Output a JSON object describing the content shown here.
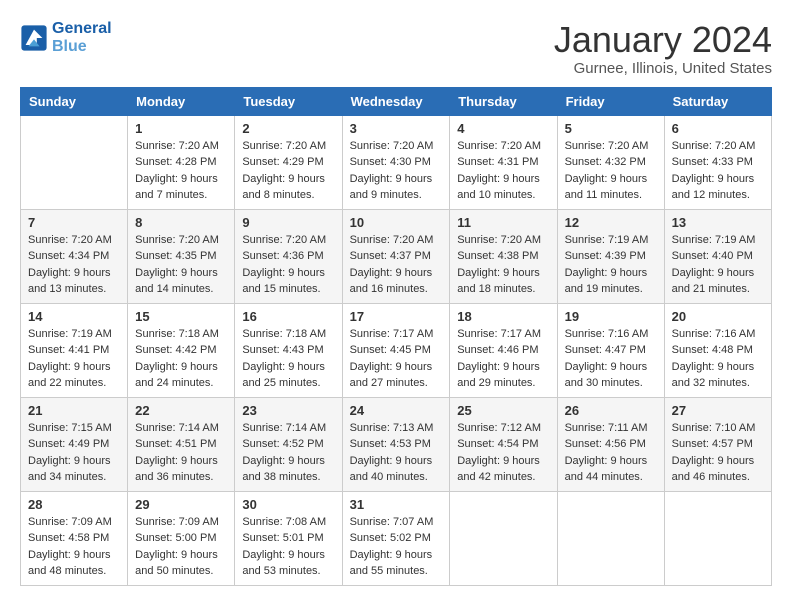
{
  "header": {
    "logo_line1": "General",
    "logo_line2": "Blue",
    "title": "January 2024",
    "location": "Gurnee, Illinois, United States"
  },
  "columns": [
    "Sunday",
    "Monday",
    "Tuesday",
    "Wednesday",
    "Thursday",
    "Friday",
    "Saturday"
  ],
  "weeks": [
    [
      {
        "day": "",
        "sunrise": "",
        "sunset": "",
        "daylight": ""
      },
      {
        "day": "1",
        "sunrise": "Sunrise: 7:20 AM",
        "sunset": "Sunset: 4:28 PM",
        "daylight": "Daylight: 9 hours and 7 minutes."
      },
      {
        "day": "2",
        "sunrise": "Sunrise: 7:20 AM",
        "sunset": "Sunset: 4:29 PM",
        "daylight": "Daylight: 9 hours and 8 minutes."
      },
      {
        "day": "3",
        "sunrise": "Sunrise: 7:20 AM",
        "sunset": "Sunset: 4:30 PM",
        "daylight": "Daylight: 9 hours and 9 minutes."
      },
      {
        "day": "4",
        "sunrise": "Sunrise: 7:20 AM",
        "sunset": "Sunset: 4:31 PM",
        "daylight": "Daylight: 9 hours and 10 minutes."
      },
      {
        "day": "5",
        "sunrise": "Sunrise: 7:20 AM",
        "sunset": "Sunset: 4:32 PM",
        "daylight": "Daylight: 9 hours and 11 minutes."
      },
      {
        "day": "6",
        "sunrise": "Sunrise: 7:20 AM",
        "sunset": "Sunset: 4:33 PM",
        "daylight": "Daylight: 9 hours and 12 minutes."
      }
    ],
    [
      {
        "day": "7",
        "sunrise": "Sunrise: 7:20 AM",
        "sunset": "Sunset: 4:34 PM",
        "daylight": "Daylight: 9 hours and 13 minutes."
      },
      {
        "day": "8",
        "sunrise": "Sunrise: 7:20 AM",
        "sunset": "Sunset: 4:35 PM",
        "daylight": "Daylight: 9 hours and 14 minutes."
      },
      {
        "day": "9",
        "sunrise": "Sunrise: 7:20 AM",
        "sunset": "Sunset: 4:36 PM",
        "daylight": "Daylight: 9 hours and 15 minutes."
      },
      {
        "day": "10",
        "sunrise": "Sunrise: 7:20 AM",
        "sunset": "Sunset: 4:37 PM",
        "daylight": "Daylight: 9 hours and 16 minutes."
      },
      {
        "day": "11",
        "sunrise": "Sunrise: 7:20 AM",
        "sunset": "Sunset: 4:38 PM",
        "daylight": "Daylight: 9 hours and 18 minutes."
      },
      {
        "day": "12",
        "sunrise": "Sunrise: 7:19 AM",
        "sunset": "Sunset: 4:39 PM",
        "daylight": "Daylight: 9 hours and 19 minutes."
      },
      {
        "day": "13",
        "sunrise": "Sunrise: 7:19 AM",
        "sunset": "Sunset: 4:40 PM",
        "daylight": "Daylight: 9 hours and 21 minutes."
      }
    ],
    [
      {
        "day": "14",
        "sunrise": "Sunrise: 7:19 AM",
        "sunset": "Sunset: 4:41 PM",
        "daylight": "Daylight: 9 hours and 22 minutes."
      },
      {
        "day": "15",
        "sunrise": "Sunrise: 7:18 AM",
        "sunset": "Sunset: 4:42 PM",
        "daylight": "Daylight: 9 hours and 24 minutes."
      },
      {
        "day": "16",
        "sunrise": "Sunrise: 7:18 AM",
        "sunset": "Sunset: 4:43 PM",
        "daylight": "Daylight: 9 hours and 25 minutes."
      },
      {
        "day": "17",
        "sunrise": "Sunrise: 7:17 AM",
        "sunset": "Sunset: 4:45 PM",
        "daylight": "Daylight: 9 hours and 27 minutes."
      },
      {
        "day": "18",
        "sunrise": "Sunrise: 7:17 AM",
        "sunset": "Sunset: 4:46 PM",
        "daylight": "Daylight: 9 hours and 29 minutes."
      },
      {
        "day": "19",
        "sunrise": "Sunrise: 7:16 AM",
        "sunset": "Sunset: 4:47 PM",
        "daylight": "Daylight: 9 hours and 30 minutes."
      },
      {
        "day": "20",
        "sunrise": "Sunrise: 7:16 AM",
        "sunset": "Sunset: 4:48 PM",
        "daylight": "Daylight: 9 hours and 32 minutes."
      }
    ],
    [
      {
        "day": "21",
        "sunrise": "Sunrise: 7:15 AM",
        "sunset": "Sunset: 4:49 PM",
        "daylight": "Daylight: 9 hours and 34 minutes."
      },
      {
        "day": "22",
        "sunrise": "Sunrise: 7:14 AM",
        "sunset": "Sunset: 4:51 PM",
        "daylight": "Daylight: 9 hours and 36 minutes."
      },
      {
        "day": "23",
        "sunrise": "Sunrise: 7:14 AM",
        "sunset": "Sunset: 4:52 PM",
        "daylight": "Daylight: 9 hours and 38 minutes."
      },
      {
        "day": "24",
        "sunrise": "Sunrise: 7:13 AM",
        "sunset": "Sunset: 4:53 PM",
        "daylight": "Daylight: 9 hours and 40 minutes."
      },
      {
        "day": "25",
        "sunrise": "Sunrise: 7:12 AM",
        "sunset": "Sunset: 4:54 PM",
        "daylight": "Daylight: 9 hours and 42 minutes."
      },
      {
        "day": "26",
        "sunrise": "Sunrise: 7:11 AM",
        "sunset": "Sunset: 4:56 PM",
        "daylight": "Daylight: 9 hours and 44 minutes."
      },
      {
        "day": "27",
        "sunrise": "Sunrise: 7:10 AM",
        "sunset": "Sunset: 4:57 PM",
        "daylight": "Daylight: 9 hours and 46 minutes."
      }
    ],
    [
      {
        "day": "28",
        "sunrise": "Sunrise: 7:09 AM",
        "sunset": "Sunset: 4:58 PM",
        "daylight": "Daylight: 9 hours and 48 minutes."
      },
      {
        "day": "29",
        "sunrise": "Sunrise: 7:09 AM",
        "sunset": "Sunset: 5:00 PM",
        "daylight": "Daylight: 9 hours and 50 minutes."
      },
      {
        "day": "30",
        "sunrise": "Sunrise: 7:08 AM",
        "sunset": "Sunset: 5:01 PM",
        "daylight": "Daylight: 9 hours and 53 minutes."
      },
      {
        "day": "31",
        "sunrise": "Sunrise: 7:07 AM",
        "sunset": "Sunset: 5:02 PM",
        "daylight": "Daylight: 9 hours and 55 minutes."
      },
      {
        "day": "",
        "sunrise": "",
        "sunset": "",
        "daylight": ""
      },
      {
        "day": "",
        "sunrise": "",
        "sunset": "",
        "daylight": ""
      },
      {
        "day": "",
        "sunrise": "",
        "sunset": "",
        "daylight": ""
      }
    ]
  ]
}
